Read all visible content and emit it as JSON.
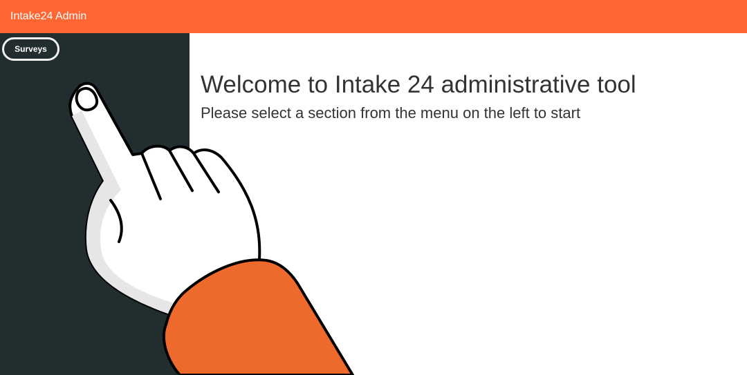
{
  "header": {
    "app_title": "Intake24 Admin",
    "brand_color": "#ff6633"
  },
  "sidebar": {
    "background_color": "#222d30",
    "items": [
      {
        "label": "Surveys",
        "highlighted": true
      }
    ]
  },
  "main": {
    "title": "Welcome to Intake 24 administrative tool",
    "subtitle": "Please select a section from the menu on the left to start"
  },
  "overlay": {
    "icon": "pointing-hand-icon",
    "sleeve_color": "#ee6a2c"
  }
}
